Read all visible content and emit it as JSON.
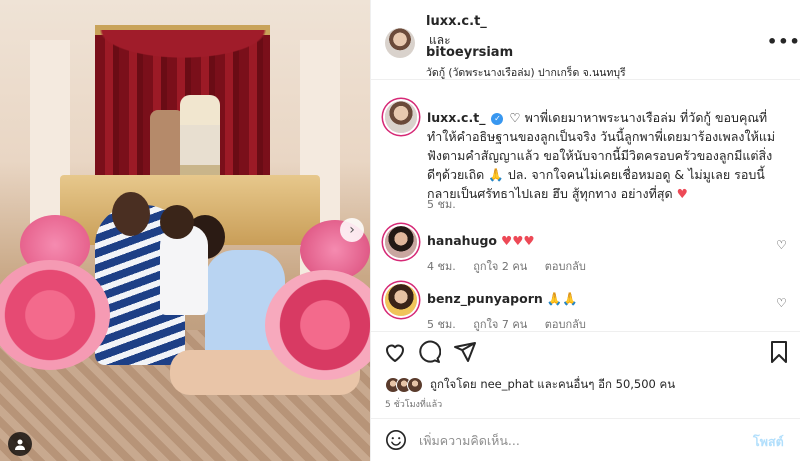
{
  "post": {
    "header": {
      "author": "luxx.c.t_",
      "conjunction": "และ",
      "collaborator": "bitoeyrsiam",
      "location": "วัดกู้ (วัดพระนางเรือล่ม) ปากเกร็ด จ.นนทบุรี",
      "more_label": "•••"
    },
    "caption": {
      "username": "luxx.c.t_",
      "text_part1": "พาพี่เดยมาหาพระนางเรือล่ม ที่วัดกู้ ขอบคุณที่ทำให้คำอธิษฐานของลูกเป็นจริง วันนี้ลูกพาพี่เดยมาร้องเพลงให้แม่ฟังตามคำสัญญาแล้ว ขอให้นับจากนี้มีวิตครอบครัวของลูกมีแต่สิ่งดีๆด้วยเถิด",
      "text_part2": "ปล. จากใจคนไม่เคยเชื่อหมอดู & ไม่มูเลย รอบนี้กลายเป็นศรัทธาไปเลย ฮึบ สู้ทุกทาง อย่างที่สุด",
      "time": "5 ชม."
    },
    "comments": [
      {
        "username": "hanahugo",
        "text": "♥♥♥",
        "time": "4 ชม.",
        "likes": "ถูกใจ 2 คน",
        "reply": "ตอบกลับ"
      },
      {
        "username": "benz_punyaporn",
        "text": "🙏🙏",
        "time": "5 ชม.",
        "likes": "ถูกใจ 7 คน",
        "reply": "ตอบกลับ"
      }
    ],
    "liked_by": "ถูกใจโดย nee_phat และคนอื่นๆ อีก 50,500 คน",
    "posted_time": "5 ชั่วโมงที่แล้ว",
    "add_comment_placeholder": "เพิ่มความคิดเห็น...",
    "post_button": "โพสต์"
  },
  "icons": {
    "caption_heart": "heart-outline-icon",
    "verified": "verified-badge-icon",
    "like": "heart-icon",
    "comment": "comment-icon",
    "share": "send-icon",
    "save": "bookmark-icon",
    "emoji": "emoji-icon",
    "carousel_next": "chevron-right-icon",
    "tags": "user-tag-icon"
  },
  "colors": {
    "text": "#262626",
    "secondary": "#737373",
    "link_blue": "#3897f0",
    "post_disabled": "#b2dffc",
    "heart_red": "#ed4956",
    "story_ring": "#d62976"
  }
}
